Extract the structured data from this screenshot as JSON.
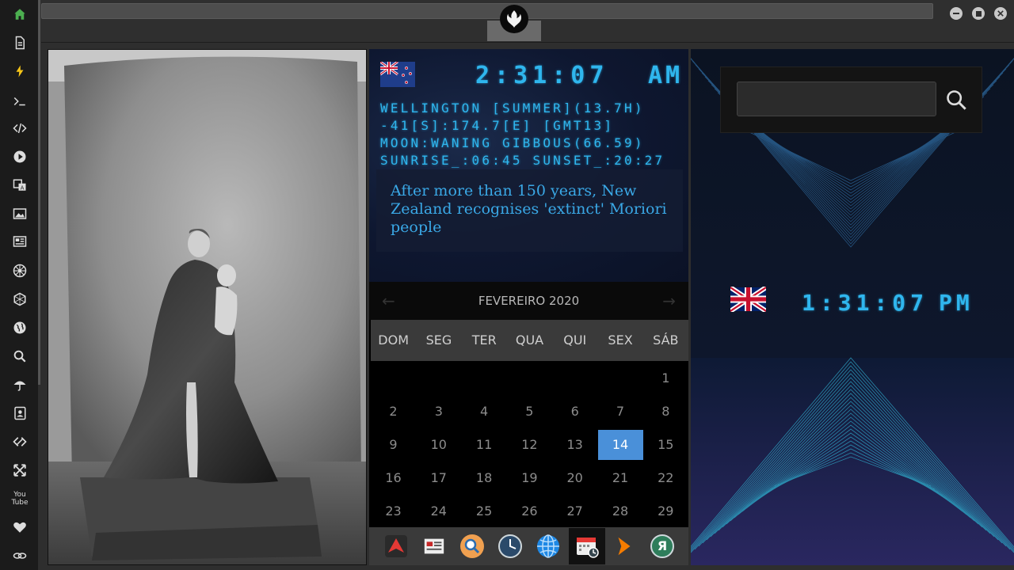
{
  "sidebar": {
    "items": [
      {
        "icon": "home-icon"
      },
      {
        "icon": "document-icon"
      },
      {
        "icon": "lightning-icon"
      },
      {
        "icon": "terminal-icon"
      },
      {
        "icon": "code-icon"
      },
      {
        "icon": "play-icon"
      },
      {
        "icon": "translate-icon"
      },
      {
        "icon": "image-icon"
      },
      {
        "icon": "news-icon"
      },
      {
        "icon": "galactic-empire-icon"
      },
      {
        "icon": "hexagon-icon"
      },
      {
        "icon": "globe-icon"
      },
      {
        "icon": "search-icon"
      },
      {
        "icon": "umbrella-icon"
      },
      {
        "icon": "contact-icon"
      },
      {
        "icon": "link-code-icon"
      },
      {
        "icon": "expand-icon"
      },
      {
        "icon": "youtube-icon"
      },
      {
        "icon": "heart-icon"
      },
      {
        "icon": "cloud-link-icon"
      }
    ],
    "youtube_label": "You Tube"
  },
  "colors": {
    "digital": "#2fb6ee",
    "selected_day": "#4a90d9",
    "sidebar_bg": "#1b1b1b",
    "home_green": "#4caf50"
  },
  "nz_clock": {
    "time": "2:31:07",
    "ampm": "AM",
    "line1": "WELLINGTON [SUMMER](13.7H)",
    "line2": "-41[S]:174.7[E] [GMT13]",
    "line3": "MOON:WANING GIBBOUS(66.59)",
    "line4": "SUNRISE_:06:45 SUNSET_:20:27"
  },
  "news": {
    "headline": "After more than 150 years, New Zealand recognises 'extinct' Moriori people"
  },
  "calendar": {
    "month_label": "FEVEREIRO 2020",
    "prev": "←",
    "next": "→",
    "weekdays": [
      "DOM",
      "SEG",
      "TER",
      "QUA",
      "QUI",
      "SEX",
      "SÁB"
    ],
    "weeks": [
      [
        "",
        "",
        "",
        "",
        "",
        "",
        "1"
      ],
      [
        "2",
        "3",
        "4",
        "5",
        "6",
        "7",
        "8"
      ],
      [
        "9",
        "10",
        "11",
        "12",
        "13",
        "14",
        "15"
      ],
      [
        "16",
        "17",
        "18",
        "19",
        "20",
        "21",
        "22"
      ],
      [
        "23",
        "24",
        "25",
        "26",
        "27",
        "28",
        "29"
      ]
    ],
    "selected": "14"
  },
  "dock": {
    "items": [
      {
        "icon": "red-arrow-app-icon"
      },
      {
        "icon": "newspaper-app-icon"
      },
      {
        "icon": "search-app-icon"
      },
      {
        "icon": "clock-app-icon"
      },
      {
        "icon": "globe-app-icon"
      },
      {
        "icon": "calendar-clock-app-icon"
      },
      {
        "icon": "forward-app-icon"
      },
      {
        "icon": "yandex-app-icon"
      }
    ],
    "yandex_letter": "Я"
  },
  "search": {
    "placeholder": "",
    "value": ""
  },
  "uk_clock": {
    "time": "1:31:07",
    "ampm": "PM"
  }
}
